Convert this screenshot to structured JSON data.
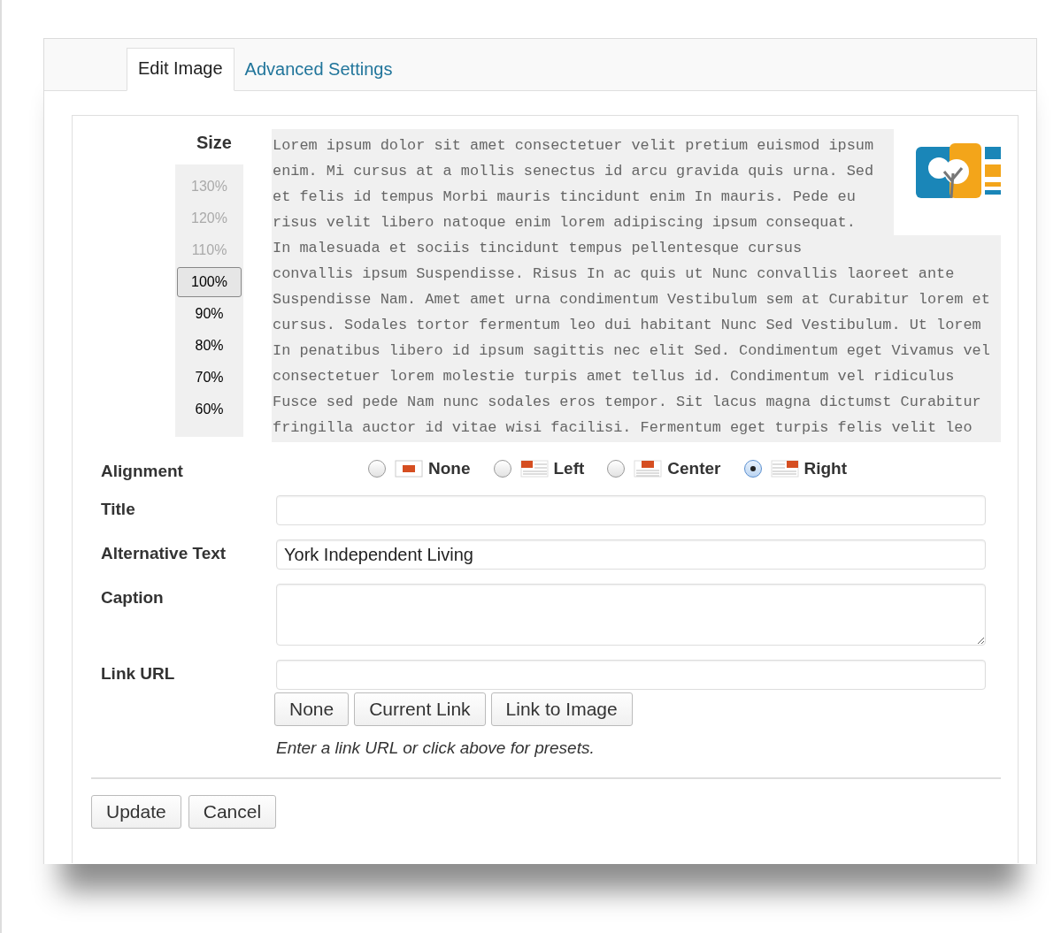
{
  "tabs": [
    {
      "label": "Edit Image",
      "selected": true
    },
    {
      "label": "Advanced Settings",
      "selected": false
    }
  ],
  "size": {
    "label": "Size",
    "options": [
      {
        "label": "130%",
        "disabled": true,
        "selected": false
      },
      {
        "label": "120%",
        "disabled": true,
        "selected": false
      },
      {
        "label": "110%",
        "disabled": true,
        "selected": false
      },
      {
        "label": "100%",
        "disabled": false,
        "selected": true
      },
      {
        "label": "90%",
        "disabled": false,
        "selected": false
      },
      {
        "label": "80%",
        "disabled": false,
        "selected": false
      },
      {
        "label": "70%",
        "disabled": false,
        "selected": false
      },
      {
        "label": "60%",
        "disabled": false,
        "selected": false
      }
    ]
  },
  "preview": {
    "wrapped_lines": [
      "Lorem ipsum dolor sit amet consectetuer velit pretium euismod ipsum",
      "enim. Mi cursus at a mollis senectus id arcu gravida quis urna. Sed",
      "et felis id tempus Morbi mauris tincidunt enim In mauris. Pede eu",
      "risus velit libero natoque enim lorem adipiscing ipsum consequat."
    ],
    "lines": [
      "In malesuada et sociis tincidunt tempus pellentesque cursus",
      "convallis ipsum Suspendisse. Risus In ac quis ut Nunc convallis laoreet ante",
      "Suspendisse Nam. Amet amet urna condimentum Vestibulum sem at Curabitur lorem et",
      "cursus. Sodales tortor fermentum leo dui habitant Nunc Sed Vestibulum. Ut lorem",
      "In penatibus libero id ipsum sagittis nec elit Sed. Condimentum eget Vivamus vel",
      "consectetuer lorem molestie turpis amet tellus id. Condimentum vel ridiculus",
      "Fusce sed pede Nam nunc sodales eros tempor. Sit lacus magna dictumst Curabitur",
      "fringilla auctor id vitae wisi facilisi. Fermentum eget turpis felis velit leo"
    ]
  },
  "alignment": {
    "label": "Alignment",
    "options": [
      {
        "label": "None",
        "kind": "none",
        "selected": false
      },
      {
        "label": "Left",
        "kind": "left",
        "selected": false
      },
      {
        "label": "Center",
        "kind": "center",
        "selected": false
      },
      {
        "label": "Right",
        "kind": "right",
        "selected": true
      }
    ]
  },
  "fields": [
    {
      "label": "Title",
      "kind": "input"
    },
    {
      "label": "Alternative Text",
      "kind": "input",
      "value": "York Independent Living"
    },
    {
      "label": "Caption",
      "kind": "textarea"
    },
    {
      "label": "Link URL",
      "kind": "input"
    }
  ],
  "link_buttons": [
    "None",
    "Current Link",
    "Link to Image"
  ],
  "link_hint": "Enter a link URL or click above for presets.",
  "actions": [
    "Update",
    "Cancel"
  ]
}
